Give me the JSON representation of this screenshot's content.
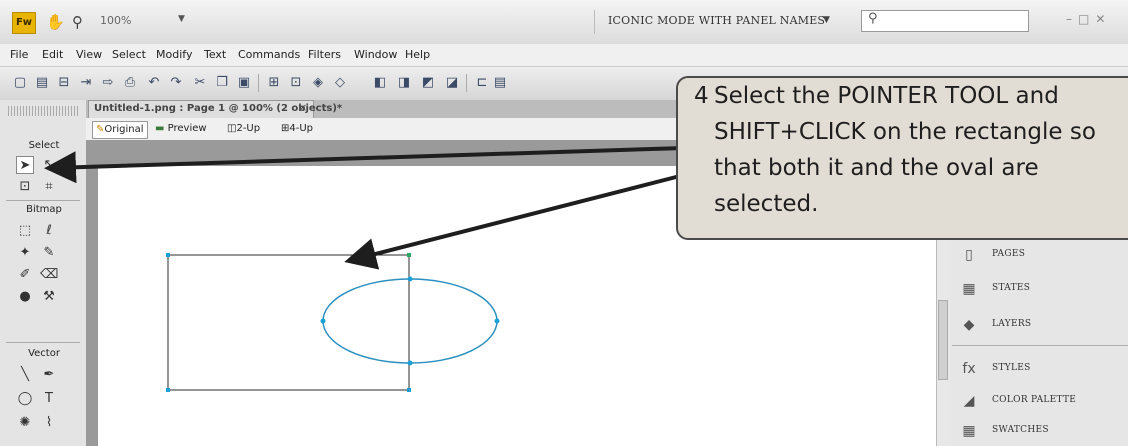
{
  "app": {
    "logo": "Fw",
    "zoom": "100%",
    "workspace": "ICONIC MODE WITH PANEL NAMES",
    "search_placeholder": ""
  },
  "menu": [
    "File",
    "Edit",
    "View",
    "Select",
    "Modify",
    "Text",
    "Commands",
    "Filters",
    "Window",
    "Help"
  ],
  "document": {
    "tab_title": "Untitled-1.png : Page 1 @ 100% (2 objects)*",
    "close": "×"
  },
  "view_buttons": {
    "original": "Original",
    "preview": "Preview",
    "two_up": "2-Up",
    "four_up": "4-Up"
  },
  "tools": {
    "select_label": "Select",
    "bitmap_label": "Bitmap",
    "vector_label": "Vector"
  },
  "panels": [
    "PAGES",
    "STATES",
    "LAYERS",
    "STYLES",
    "COLOR PALETTE",
    "SWATCHES"
  ],
  "callout": {
    "number": "4",
    "text": "Select the POINTER TOOL and SHIFT+CLICK on the rectangle so that both it and the oval are selected."
  },
  "colors": {
    "selection": "#1aa0d6",
    "oval_stroke": "#2a8fc0",
    "callout_bg": "#e2ddd4",
    "logo": "#e8b400"
  }
}
